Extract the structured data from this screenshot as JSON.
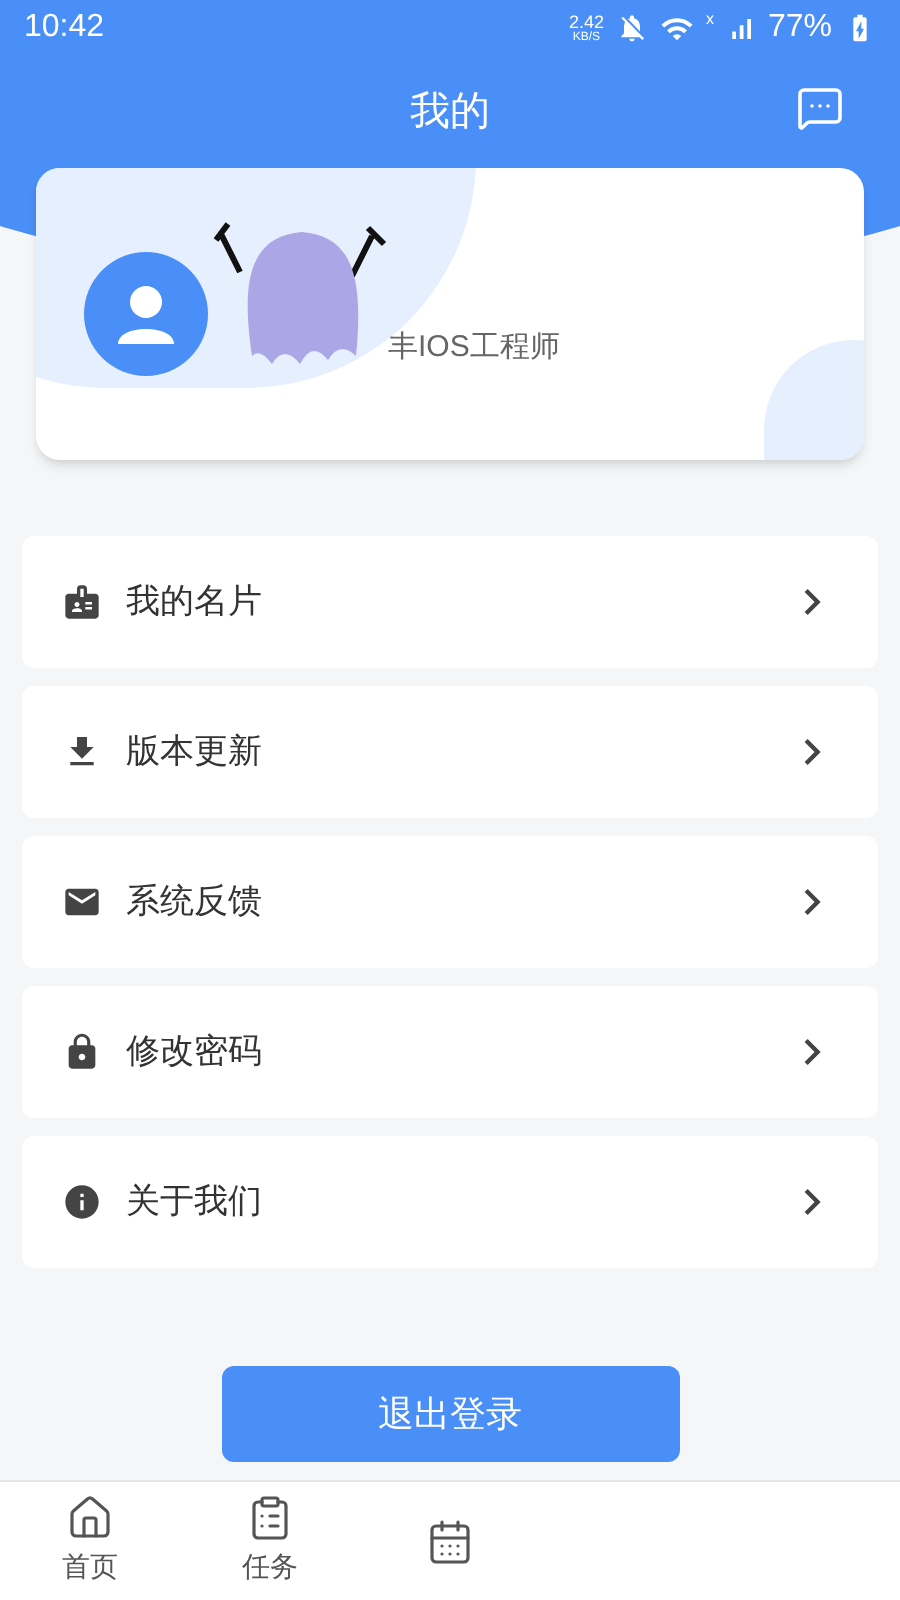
{
  "status_bar": {
    "time": "10:42",
    "net_speed": "2.42",
    "net_unit": "KB/S",
    "signal_mark": "x",
    "battery": "77%"
  },
  "header": {
    "title": "我的"
  },
  "profile": {
    "subtitle": "丰IOS工程师"
  },
  "menu": [
    {
      "kind": "card",
      "label": "我的名片"
    },
    {
      "kind": "download",
      "label": "版本更新"
    },
    {
      "kind": "mail",
      "label": "系统反馈"
    },
    {
      "kind": "lock",
      "label": "修改密码"
    },
    {
      "kind": "info",
      "label": "关于我们"
    }
  ],
  "logout_button": "退出登录",
  "bottom_nav": [
    {
      "kind": "home",
      "label": "首页"
    },
    {
      "kind": "task",
      "label": "任务"
    },
    {
      "kind": "calendar"
    }
  ]
}
